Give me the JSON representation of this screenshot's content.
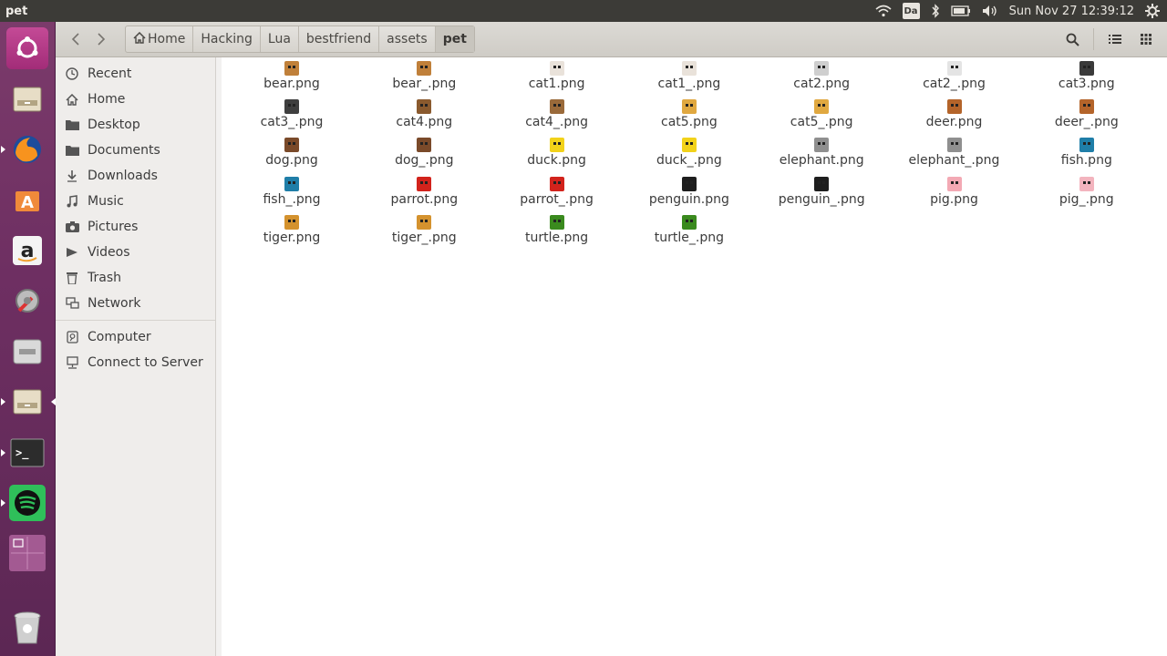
{
  "window": {
    "title": "pet"
  },
  "panel": {
    "keyboard": "Da",
    "datetime": "Sun Nov 27 12:39:12"
  },
  "breadcrumbs": [
    "Home",
    "Hacking",
    "Lua",
    "bestfriend",
    "assets",
    "pet"
  ],
  "sidebar": {
    "places": [
      {
        "label": "Recent",
        "icon": "clock-icon"
      },
      {
        "label": "Home",
        "icon": "home-icon"
      },
      {
        "label": "Desktop",
        "icon": "folder-icon"
      },
      {
        "label": "Documents",
        "icon": "folder-icon"
      },
      {
        "label": "Downloads",
        "icon": "download-icon"
      },
      {
        "label": "Music",
        "icon": "music-icon"
      },
      {
        "label": "Pictures",
        "icon": "camera-icon"
      },
      {
        "label": "Videos",
        "icon": "video-icon"
      },
      {
        "label": "Trash",
        "icon": "trash-icon"
      },
      {
        "label": "Network",
        "icon": "network-icon"
      }
    ],
    "devices": [
      {
        "label": "Computer",
        "icon": "computer-icon"
      },
      {
        "label": "Connect to Server",
        "icon": "server-icon"
      }
    ]
  },
  "files": [
    {
      "name": "bear.png",
      "color": "#c0803a"
    },
    {
      "name": "bear_.png",
      "color": "#c0803a"
    },
    {
      "name": "cat1.png",
      "color": "#e9e2da"
    },
    {
      "name": "cat1_.png",
      "color": "#e9e2da"
    },
    {
      "name": "cat2.png",
      "color": "#cfcfcf"
    },
    {
      "name": "cat2_.png",
      "color": "#e4e4e4"
    },
    {
      "name": "cat3.png",
      "color": "#3a3a3a"
    },
    {
      "name": "cat3_.png",
      "color": "#3f3f3f"
    },
    {
      "name": "cat4.png",
      "color": "#8a5a2e"
    },
    {
      "name": "cat4_.png",
      "color": "#9a6a3a"
    },
    {
      "name": "cat5.png",
      "color": "#e0a840"
    },
    {
      "name": "cat5_.png",
      "color": "#e0a840"
    },
    {
      "name": "deer.png",
      "color": "#b4642a"
    },
    {
      "name": "deer_.png",
      "color": "#b4642a"
    },
    {
      "name": "dog.png",
      "color": "#7a4a2a"
    },
    {
      "name": "dog_.png",
      "color": "#7a4a2a"
    },
    {
      "name": "duck.png",
      "color": "#f2d21a"
    },
    {
      "name": "duck_.png",
      "color": "#f2d21a"
    },
    {
      "name": "elephant.png",
      "color": "#8f8f8f"
    },
    {
      "name": "elephant_.png",
      "color": "#8f8f8f"
    },
    {
      "name": "fish.png",
      "color": "#1f7ea8"
    },
    {
      "name": "fish_.png",
      "color": "#1f7ea8"
    },
    {
      "name": "parrot.png",
      "color": "#d2231c"
    },
    {
      "name": "parrot_.png",
      "color": "#d2231c"
    },
    {
      "name": "penguin.png",
      "color": "#1e1e1e"
    },
    {
      "name": "penguin_.png",
      "color": "#1e1e1e"
    },
    {
      "name": "pig.png",
      "color": "#f3a9b4"
    },
    {
      "name": "pig_.png",
      "color": "#f3b4be"
    },
    {
      "name": "tiger.png",
      "color": "#d4922e"
    },
    {
      "name": "tiger_.png",
      "color": "#d4922e"
    },
    {
      "name": "turtle.png",
      "color": "#3a8a1e"
    },
    {
      "name": "turtle_.png",
      "color": "#3a8a1e"
    }
  ],
  "launcher": [
    {
      "name": "ubuntu-dash-icon",
      "color": "#c03a8c"
    },
    {
      "name": "files-icon",
      "color": "#b8a98a"
    },
    {
      "name": "firefox-icon",
      "color": "#e66a1e"
    },
    {
      "name": "software-center-icon",
      "color": "#e8652a"
    },
    {
      "name": "amazon-icon",
      "color": "#e8e8e8"
    },
    {
      "name": "system-settings-icon",
      "color": "#9a9a9a"
    },
    {
      "name": "backups-icon",
      "color": "#b8b8b8"
    },
    {
      "name": "files-active-icon",
      "color": "#d9c9a6"
    },
    {
      "name": "terminal-icon",
      "color": "#2c2c2c"
    },
    {
      "name": "spotify-icon",
      "color": "#2fbf5a"
    },
    {
      "name": "workspace-switcher-icon",
      "color": "#a05890"
    },
    {
      "name": "trash-launcher-icon",
      "color": "#cfcfcf"
    }
  ]
}
